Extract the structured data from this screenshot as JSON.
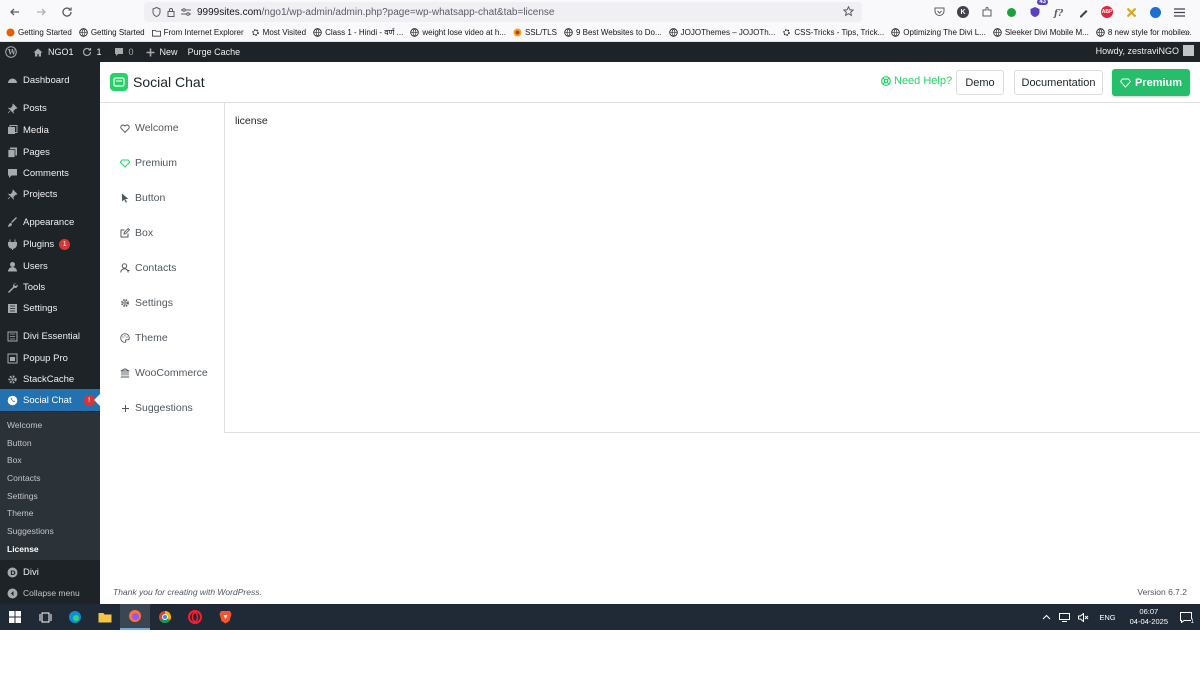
{
  "browser": {
    "url_host": "9999sites.com",
    "url_path": "/ngo1/wp-admin/admin.php?page=wp-whatsapp-chat&tab=license",
    "extension_badge": "43",
    "bookmarks": [
      {
        "label": "Getting Started",
        "icon": "firefox-icon"
      },
      {
        "label": "Getting Started",
        "icon": "globe-icon"
      },
      {
        "label": "From Internet Explorer",
        "icon": "folder-icon"
      },
      {
        "label": "Most Visited",
        "icon": "gear-icon"
      },
      {
        "label": "Class 1 - Hindi - वर्ण ...",
        "icon": "globe-icon"
      },
      {
        "label": "weight lose video at h...",
        "icon": "globe-icon"
      },
      {
        "label": "SSL/TLS",
        "icon": "ssl-icon"
      },
      {
        "label": "9 Best Websites to Do...",
        "icon": "globe-icon"
      },
      {
        "label": "JOJOThemes – JOJOTh...",
        "icon": "globe-icon"
      },
      {
        "label": "CSS-Tricks - Tips, Trick...",
        "icon": "gear-icon"
      },
      {
        "label": "Optimizing The Divi L...",
        "icon": "globe-icon"
      },
      {
        "label": "Sleeker Divi Mobile M...",
        "icon": "globe-icon"
      },
      {
        "label": "8 new style for mobile...",
        "icon": "globe-icon"
      }
    ]
  },
  "adminbar": {
    "site_name": "NGO1",
    "updates_count": "1",
    "comments_count": "0",
    "new_label": "New",
    "purge_label": "Purge Cache",
    "howdy": "Howdy, zestraviNGO"
  },
  "sidebar": {
    "items": [
      {
        "label": "Dashboard",
        "icon": "dashboard-icon"
      },
      {
        "label": "Posts",
        "icon": "pin-icon"
      },
      {
        "label": "Media",
        "icon": "media-icon"
      },
      {
        "label": "Pages",
        "icon": "pages-icon"
      },
      {
        "label": "Comments",
        "icon": "comment-icon"
      },
      {
        "label": "Projects",
        "icon": "pin-icon"
      },
      {
        "label": "Appearance",
        "icon": "brush-icon"
      },
      {
        "label": "Plugins",
        "icon": "plugin-icon",
        "badge": "1"
      },
      {
        "label": "Users",
        "icon": "user-icon"
      },
      {
        "label": "Tools",
        "icon": "wrench-icon"
      },
      {
        "label": "Settings",
        "icon": "settings-icon"
      },
      {
        "label": "Divi Essential",
        "icon": "divi-essential-icon"
      },
      {
        "label": "Popup Pro",
        "icon": "popup-icon"
      },
      {
        "label": "StackCache",
        "icon": "gear-icon"
      },
      {
        "label": "Social Chat",
        "icon": "whatsapp-icon",
        "badge": "!"
      },
      {
        "label": "Divi",
        "icon": "divi-icon"
      },
      {
        "label": "Collapse menu",
        "icon": "collapse-icon"
      }
    ],
    "submenu": [
      "Welcome",
      "Button",
      "Box",
      "Contacts",
      "Settings",
      "Theme",
      "Suggestions",
      "License"
    ]
  },
  "plugin": {
    "title": "Social Chat",
    "need_help": "Need Help?",
    "demo": "Demo",
    "documentation": "Documentation",
    "premium": "Premium",
    "nav": [
      {
        "label": "Welcome",
        "icon": "heart-icon"
      },
      {
        "label": "Premium",
        "icon": "diamond-icon"
      },
      {
        "label": "Button",
        "icon": "cursor-icon"
      },
      {
        "label": "Box",
        "icon": "edit-box-icon"
      },
      {
        "label": "Contacts",
        "icon": "contacts-icon"
      },
      {
        "label": "Settings",
        "icon": "gear-icon"
      },
      {
        "label": "Theme",
        "icon": "palette-icon"
      },
      {
        "label": "WooCommerce",
        "icon": "bank-icon"
      },
      {
        "label": "Suggestions",
        "icon": "plus-icon"
      }
    ],
    "content": "license"
  },
  "footer": {
    "thanks": "Thank you for creating with WordPress.",
    "version": "Version 6.7.2"
  },
  "taskbar": {
    "language": "ENG",
    "time": "06:07",
    "date": "04-04-2025",
    "notifications": "1"
  },
  "colors": {
    "wp_dark": "#1d2327",
    "wp_blue": "#2271b1",
    "whatsapp_green": "#25d366",
    "taskbar": "#202a36"
  }
}
